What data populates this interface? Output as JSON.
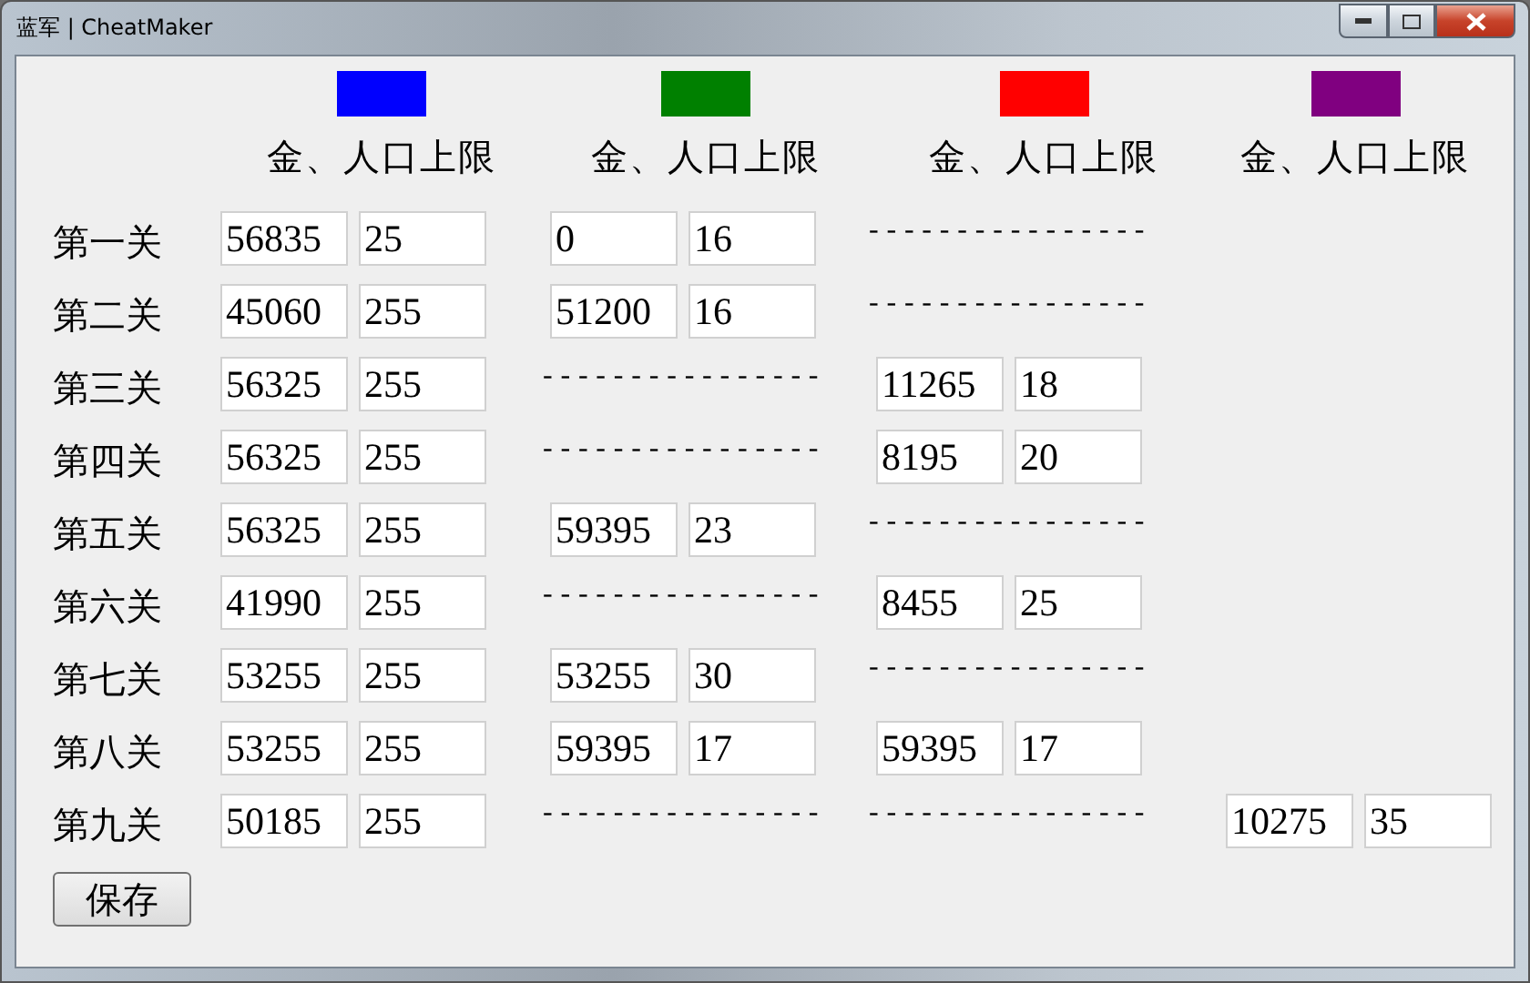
{
  "window": {
    "title": "蓝军 | CheatMaker"
  },
  "teams": [
    {
      "color": "#0000ff",
      "header": "金、人口上限"
    },
    {
      "color": "#008000",
      "header": "金、人口上限"
    },
    {
      "color": "#ff0000",
      "header": "金、人口上限"
    },
    {
      "color": "#800080",
      "header": "金、人口上限"
    }
  ],
  "stages": [
    {
      "label": "第一关",
      "cells": [
        {
          "kind": "fields",
          "gold": "56835",
          "pop": "25"
        },
        {
          "kind": "fields",
          "gold": "0",
          "pop": "16"
        },
        {
          "kind": "dashes",
          "text": "----------------"
        },
        {
          "kind": "empty"
        }
      ]
    },
    {
      "label": "第二关",
      "cells": [
        {
          "kind": "fields",
          "gold": "45060",
          "pop": "255"
        },
        {
          "kind": "fields",
          "gold": "51200",
          "pop": "16"
        },
        {
          "kind": "dashes",
          "text": "----------------"
        },
        {
          "kind": "empty"
        }
      ]
    },
    {
      "label": "第三关",
      "cells": [
        {
          "kind": "fields",
          "gold": "56325",
          "pop": "255"
        },
        {
          "kind": "dashes",
          "text": "----------------"
        },
        {
          "kind": "fields",
          "gold": "11265",
          "pop": "18"
        },
        {
          "kind": "empty"
        }
      ]
    },
    {
      "label": "第四关",
      "cells": [
        {
          "kind": "fields",
          "gold": "56325",
          "pop": "255"
        },
        {
          "kind": "dashes",
          "text": "----------------"
        },
        {
          "kind": "fields",
          "gold": "8195",
          "pop": "20"
        },
        {
          "kind": "empty"
        }
      ]
    },
    {
      "label": "第五关",
      "cells": [
        {
          "kind": "fields",
          "gold": "56325",
          "pop": "255"
        },
        {
          "kind": "fields",
          "gold": "59395",
          "pop": "23"
        },
        {
          "kind": "dashes",
          "text": "----------------"
        },
        {
          "kind": "empty"
        }
      ]
    },
    {
      "label": "第六关",
      "cells": [
        {
          "kind": "fields",
          "gold": "41990",
          "pop": "255"
        },
        {
          "kind": "dashes",
          "text": "----------------"
        },
        {
          "kind": "fields",
          "gold": "8455",
          "pop": "25"
        },
        {
          "kind": "empty"
        }
      ]
    },
    {
      "label": "第七关",
      "cells": [
        {
          "kind": "fields",
          "gold": "53255",
          "pop": "255"
        },
        {
          "kind": "fields",
          "gold": "53255",
          "pop": "30"
        },
        {
          "kind": "dashes",
          "text": "----------------"
        },
        {
          "kind": "empty"
        }
      ]
    },
    {
      "label": "第八关",
      "cells": [
        {
          "kind": "fields",
          "gold": "53255",
          "pop": "255"
        },
        {
          "kind": "fields",
          "gold": "59395",
          "pop": "17"
        },
        {
          "kind": "fields",
          "gold": "59395",
          "pop": "17"
        },
        {
          "kind": "empty"
        }
      ]
    },
    {
      "label": "第九关",
      "cells": [
        {
          "kind": "fields",
          "gold": "50185",
          "pop": "255"
        },
        {
          "kind": "dashes",
          "text": "----------------"
        },
        {
          "kind": "dashes",
          "text": "----------------"
        },
        {
          "kind": "fields",
          "gold": "10275",
          "pop": "35"
        }
      ]
    }
  ],
  "save_button": "保存"
}
